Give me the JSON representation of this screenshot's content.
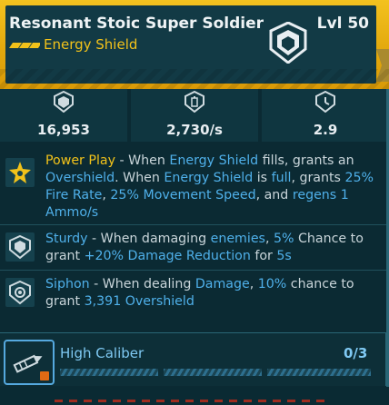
{
  "item": {
    "name": "Resonant Stoic Super Soldier",
    "level": "Lvl 50",
    "type": "Energy Shield",
    "icon": "shield-icon",
    "accent_color": "#f2c21a"
  },
  "stats": [
    {
      "icon": "shield-capacity-icon",
      "value": "16,953"
    },
    {
      "icon": "recharge-rate-icon",
      "value": "2,730/s"
    },
    {
      "icon": "recharge-delay-icon",
      "value": "2.9"
    }
  ],
  "perks": [
    {
      "icon": "power-play-star-icon",
      "name": "Power Play",
      "parts": [
        " - When ",
        "Energy Shield",
        " fills, grants an ",
        "Overshield",
        ". When ",
        "Energy Shield",
        " is ",
        "full",
        ", grants ",
        "25% Fire Rate",
        ", ",
        "25% Movement Speed",
        ", and ",
        "regens 1 Ammo/s"
      ]
    },
    {
      "icon": "sturdy-shield-icon",
      "name": "Sturdy",
      "parts": [
        " - When damaging ",
        "enemies",
        ", ",
        "5%",
        " Chance to grant ",
        "+20% Damage Reduction",
        " for ",
        "5s"
      ]
    },
    {
      "icon": "siphon-shield-icon",
      "name": "Siphon",
      "parts": [
        " - When dealing ",
        "Damage",
        ", ",
        "10%",
        " chance to grant ",
        "3,391 Overshield"
      ]
    }
  ],
  "mod": {
    "icon": "bullet-icon",
    "name": "High Caliber",
    "count": "0/3",
    "lock_icon": "lock-icon"
  }
}
